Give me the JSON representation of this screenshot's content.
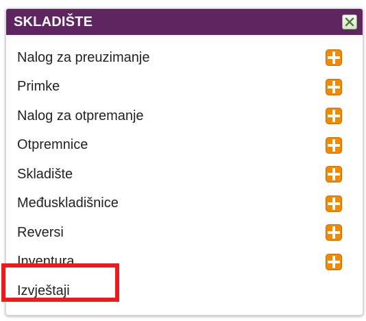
{
  "panel": {
    "title": "SKLADIŠTE",
    "close_icon": "close-icon",
    "header_color": "#5f2561",
    "add_icon_color": "#f08a00",
    "highlight_color": "#ec1c1c"
  },
  "items": [
    {
      "label": "Nalog za preuzimanje",
      "icon": "add-icon"
    },
    {
      "label": "Primke",
      "icon": "add-icon"
    },
    {
      "label": "Nalog za otpremanje",
      "icon": "add-icon"
    },
    {
      "label": "Otpremnice",
      "icon": "add-icon"
    },
    {
      "label": "Skladište",
      "icon": "add-icon"
    },
    {
      "label": "Međuskladišnice",
      "icon": "add-icon"
    },
    {
      "label": "Reversi",
      "icon": "add-icon"
    },
    {
      "label": "Inventura",
      "icon": "add-icon"
    },
    {
      "label": "Izvještaji",
      "icon": null
    }
  ]
}
